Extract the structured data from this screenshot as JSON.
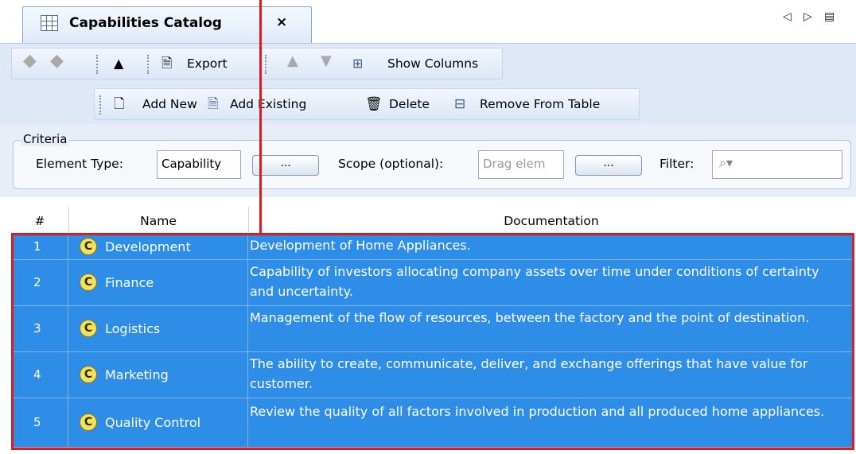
{
  "tab": {
    "title": "Capabilities Catalog",
    "close_glyph": "×",
    "controls": [
      "◁",
      "▷",
      "▤"
    ]
  },
  "toolbar1": {
    "export_label": "Export",
    "show_columns_label": "Show Columns"
  },
  "toolbar2": {
    "add_new_label": "Add New",
    "add_existing_label": "Add Existing",
    "delete_label": "Delete",
    "remove_label": "Remove From Table"
  },
  "criteria": {
    "title": "Criteria",
    "element_type_label": "Element Type:",
    "element_type_value": "Capability",
    "browse_label": "...",
    "scope_label": "Scope (optional):",
    "scope_placeholder": "Drag elem",
    "filter_label": "Filter:"
  },
  "table": {
    "columns": [
      "#",
      "Name",
      "Documentation"
    ],
    "rows": [
      {
        "num": "1",
        "name": "Development",
        "doc": "Development of Home Appliances."
      },
      {
        "num": "2",
        "name": "Finance",
        "doc": "Capability of investors allocating company assets over time under conditions of certainty and uncertainty."
      },
      {
        "num": "3",
        "name": "Logistics",
        "doc": "Management of the flow of resources, between the factory and the point of destination."
      },
      {
        "num": "4",
        "name": "Marketing",
        "doc": "The ability to create, communicate, deliver, and exchange offerings that have value for customer."
      },
      {
        "num": "5",
        "name": "Quality Control",
        "doc": "Review the quality of all factors involved in production and all produced home appliances."
      }
    ],
    "capability_icon_letter": "C"
  },
  "colors": {
    "selection": "#2e8de6",
    "highlight": "#e11919"
  }
}
